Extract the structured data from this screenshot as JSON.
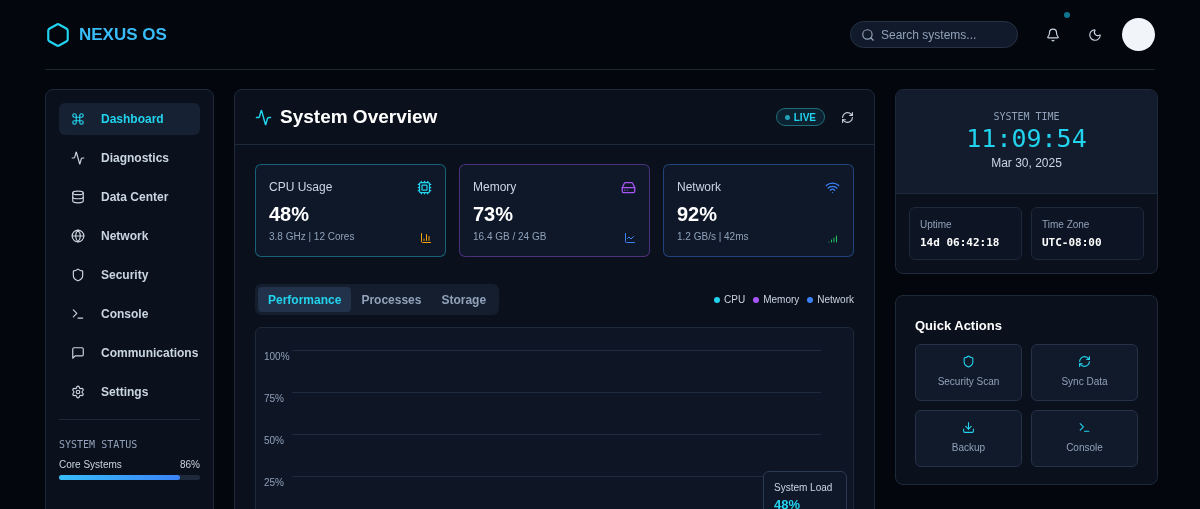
{
  "brand": "NEXUS OS",
  "header": {
    "search": {
      "placeholder": "Search systems..."
    },
    "notification_dot": true
  },
  "sidebar": {
    "items": [
      {
        "label": "Dashboard",
        "selected": true
      },
      {
        "label": "Diagnostics",
        "selected": false
      },
      {
        "label": "Data Center",
        "selected": false
      },
      {
        "label": "Network",
        "selected": false
      },
      {
        "label": "Security",
        "selected": false
      },
      {
        "label": "Console",
        "selected": false
      },
      {
        "label": "Communications",
        "selected": false
      },
      {
        "label": "Settings",
        "selected": false
      }
    ],
    "status": {
      "title": "SYSTEM STATUS",
      "meters": [
        {
          "name": "Core Systems",
          "reading": "86%",
          "level": 0.86
        }
      ]
    }
  },
  "overview": {
    "title": "System Overview",
    "live": "LIVE",
    "metrics": [
      {
        "label": "CPU Usage",
        "value": "48%",
        "detail": "3.8 GHz | 12 Cores",
        "color": "#22d3ee"
      },
      {
        "label": "Memory",
        "value": "73%",
        "detail": "16.4 GB / 24 GB",
        "color": "#a855f7"
      },
      {
        "label": "Network",
        "value": "92%",
        "detail": "1.2 GB/s | 42ms",
        "color": "#3b82f6"
      }
    ],
    "tabs": [
      {
        "label": "Performance",
        "selected": true
      },
      {
        "label": "Processes",
        "selected": false
      },
      {
        "label": "Storage",
        "selected": false
      }
    ],
    "legend": [
      {
        "label": "CPU",
        "color": "#22d3ee"
      },
      {
        "label": "Memory",
        "color": "#a855f7"
      },
      {
        "label": "Network",
        "color": "#3b82f6"
      }
    ],
    "chart": {
      "y_labels": [
        "100%",
        "75%",
        "50%",
        "25%"
      ],
      "tooltip": {
        "label": "System Load",
        "value": "48%"
      }
    }
  },
  "clock": {
    "title": "SYSTEM TIME",
    "time": "11:09:54",
    "date": "Mar 30, 2025",
    "stats": [
      {
        "label": "Uptime",
        "value": "14d 06:42:18"
      },
      {
        "label": "Time Zone",
        "value": "UTC-08:00"
      }
    ]
  },
  "quick_actions": {
    "title": "Quick Actions",
    "actions": [
      {
        "label": "Security Scan"
      },
      {
        "label": "Sync Data"
      },
      {
        "label": "Backup"
      },
      {
        "label": "Console"
      }
    ]
  }
}
